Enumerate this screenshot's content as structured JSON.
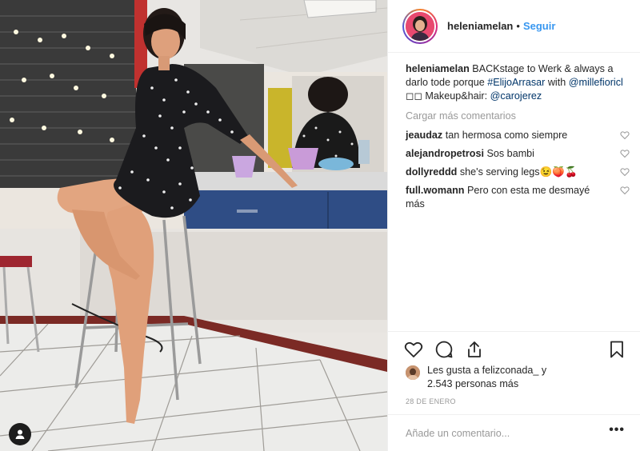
{
  "post": {
    "username": "heleniamelan",
    "separator": "•",
    "follow_label": "Seguir",
    "caption": {
      "username": "heleniamelan",
      "text_1": " BACKstage to Werk & always a darlo tode porque ",
      "hashtag": "#ElijoArrasar",
      "text_2": " with ",
      "mention_1": "@millefioricl",
      "text_3": " ◻◻ Makeup&hair: ",
      "mention_2": "@carojerez"
    },
    "load_more_label": "Cargar más comentarios",
    "comments": [
      {
        "user": "jeaudaz",
        "text": "tan hermosa como siempre"
      },
      {
        "user": "alejandropetrosi",
        "text": "Sos bambi"
      },
      {
        "user": "dollyreddd",
        "text": "she's serving legs😉🍑🍒"
      },
      {
        "user": "full.womann",
        "text": "Pero con esta me desmayé más"
      }
    ],
    "likes": {
      "prefix": "Les gusta a ",
      "user": "felizconada_",
      "suffix": " y",
      "count_text": "2.543 personas más"
    },
    "date": "28 DE ENERO",
    "add_comment_placeholder": "Añade un comentario...",
    "more_options": "•••"
  },
  "icons": {
    "heart": "heart-icon",
    "comment": "comment-icon",
    "share": "share-icon",
    "bookmark": "bookmark-icon",
    "user_tag": "user-tag-icon"
  },
  "colors": {
    "link": "#003569",
    "follow": "#3897f0",
    "muted": "#999999"
  }
}
